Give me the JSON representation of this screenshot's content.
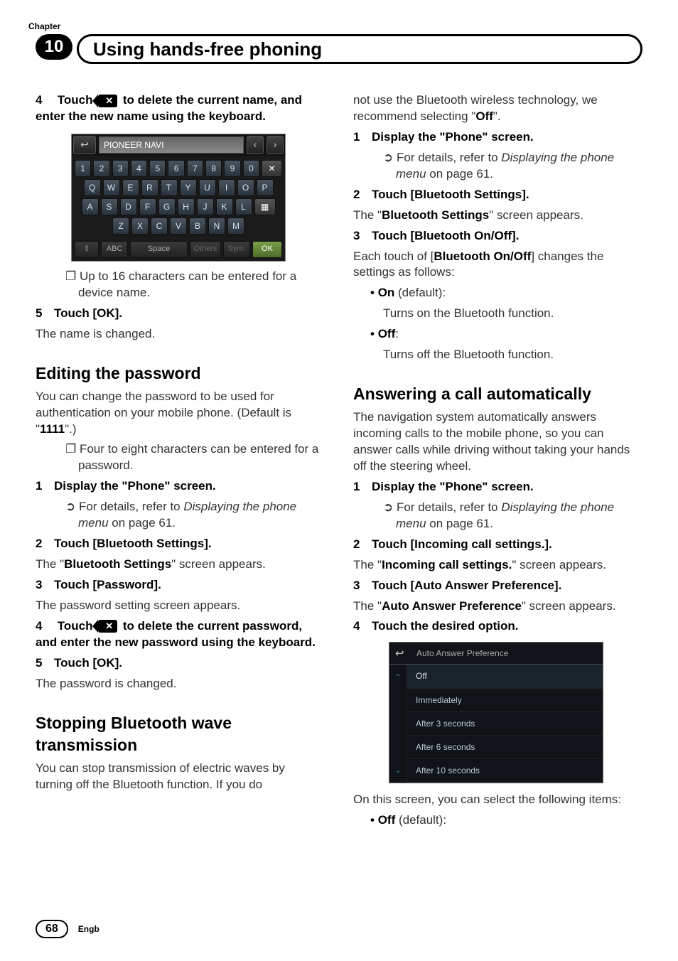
{
  "chapter_label": "Chapter",
  "chapter_number": "10",
  "chapter_title": "Using hands-free phoning",
  "page_number": "68",
  "language": "Engb",
  "left": {
    "step4_pre": "4",
    "step4_text_a": "Touch",
    "step4_text_b": "to delete the current name, and enter the new name using the keyboard.",
    "kbd_input": "PIONEER NAVI",
    "kbd_rows": {
      "r1": [
        "1",
        "2",
        "3",
        "4",
        "5",
        "6",
        "7",
        "8",
        "9",
        "0"
      ],
      "r2": [
        "Q",
        "W",
        "E",
        "R",
        "T",
        "Y",
        "U",
        "I",
        "O",
        "P"
      ],
      "r3": [
        "A",
        "S",
        "D",
        "F",
        "G",
        "H",
        "J",
        "K",
        "L"
      ],
      "r4": [
        "Z",
        "X",
        "C",
        "V",
        "B",
        "N",
        "M"
      ]
    },
    "kbd_bottom": {
      "shift": "⇧",
      "abc": "ABC",
      "space": "Space",
      "others": "Others",
      "sym": "Sym.",
      "ok": "OK"
    },
    "note_16": "Up to 16 characters can be entered for a device name.",
    "step5_num": "5",
    "step5_text": "Touch [OK].",
    "step5_body": "The name is changed.",
    "h_editpw": "Editing the password",
    "editpw_intro_a": "You can change the password to be used for authentication on your mobile phone. (Default is \"",
    "editpw_default": "1111",
    "editpw_intro_b": "\".)",
    "note_pwlen": "Four to eight characters can be entered for a password.",
    "pw_s1_num": "1",
    "pw_s1": "Display the \"Phone\" screen.",
    "pw_s1_sub_a": "For details, refer to ",
    "pw_s1_sub_i": "Displaying the phone menu",
    "pw_s1_sub_b": " on page 61.",
    "pw_s2_num": "2",
    "pw_s2": "Touch [Bluetooth Settings].",
    "pw_s2_body_a": "The \"",
    "pw_s2_body_b": "Bluetooth Settings",
    "pw_s2_body_c": "\" screen appears.",
    "pw_s3_num": "3",
    "pw_s3": "Touch [Password].",
    "pw_s3_body": "The password setting screen appears.",
    "pw_s4_num": "4",
    "pw_s4_a": "Touch",
    "pw_s4_b": "to delete the current password, and enter the new password using the keyboard.",
    "pw_s5_num": "5",
    "pw_s5": "Touch [OK].",
    "pw_s5_body": "The password is changed.",
    "h_stopbt": "Stopping Bluetooth wave transmission",
    "stopbt_body": "You can stop transmission of electric waves by turning off the Bluetooth function. If you do"
  },
  "right": {
    "cont_a": "not use the Bluetooth wireless technology, we recommend selecting \"",
    "cont_off": "Off",
    "cont_b": "\".",
    "r_s1_num": "1",
    "r_s1": "Display the \"Phone\" screen.",
    "r_s1_sub_a": "For details, refer to ",
    "r_s1_sub_i": "Displaying the phone menu",
    "r_s1_sub_b": " on page 61.",
    "r_s2_num": "2",
    "r_s2": "Touch [Bluetooth Settings].",
    "r_s2_body_a": "The \"",
    "r_s2_body_b": "Bluetooth Settings",
    "r_s2_body_c": "\" screen appears.",
    "r_s3_num": "3",
    "r_s3": "Touch [Bluetooth On/Off].",
    "r_s3_body_a": "Each touch of [",
    "r_s3_body_b": "Bluetooth On/Off",
    "r_s3_body_c": "] changes the settings as follows:",
    "r_on": "On",
    "r_on_suffix": " (default):",
    "r_on_body": "Turns on the Bluetooth function.",
    "r_off": "Off",
    "r_off_suffix": ":",
    "r_off_body": "Turns off the Bluetooth function.",
    "h_answer": "Answering a call automatically",
    "answer_intro": "The navigation system automatically answers incoming calls to the mobile phone, so you can answer calls while driving without taking your hands off the steering wheel.",
    "a_s1_num": "1",
    "a_s1": "Display the \"Phone\" screen.",
    "a_s1_sub_a": "For details, refer to ",
    "a_s1_sub_i": "Displaying the phone menu",
    "a_s1_sub_b": " on page 61.",
    "a_s2_num": "2",
    "a_s2": "Touch [Incoming call settings.].",
    "a_s2_body_a": "The \"",
    "a_s2_body_b": "Incoming call settings.",
    "a_s2_body_c": "\" screen appears.",
    "a_s3_num": "3",
    "a_s3": "Touch [Auto Answer Preference].",
    "a_s3_body_a": "The \"",
    "a_s3_body_b": "Auto Answer Preference",
    "a_s3_body_c": "\" screen appears.",
    "a_s4_num": "4",
    "a_s4": "Touch the desired option.",
    "aa_title": "Auto Answer Preference",
    "aa_items": [
      "Off",
      "Immediately",
      "After 3 seconds",
      "After 6 seconds",
      "After 10 seconds"
    ],
    "aa_after": "On this screen, you can select the following items:",
    "aa_off": "Off",
    "aa_off_suffix": " (default):"
  },
  "icons": {
    "backspace": "✕",
    "back": "↩",
    "left": "‹",
    "right": "›",
    "up": "⌃",
    "down": "⌄"
  }
}
